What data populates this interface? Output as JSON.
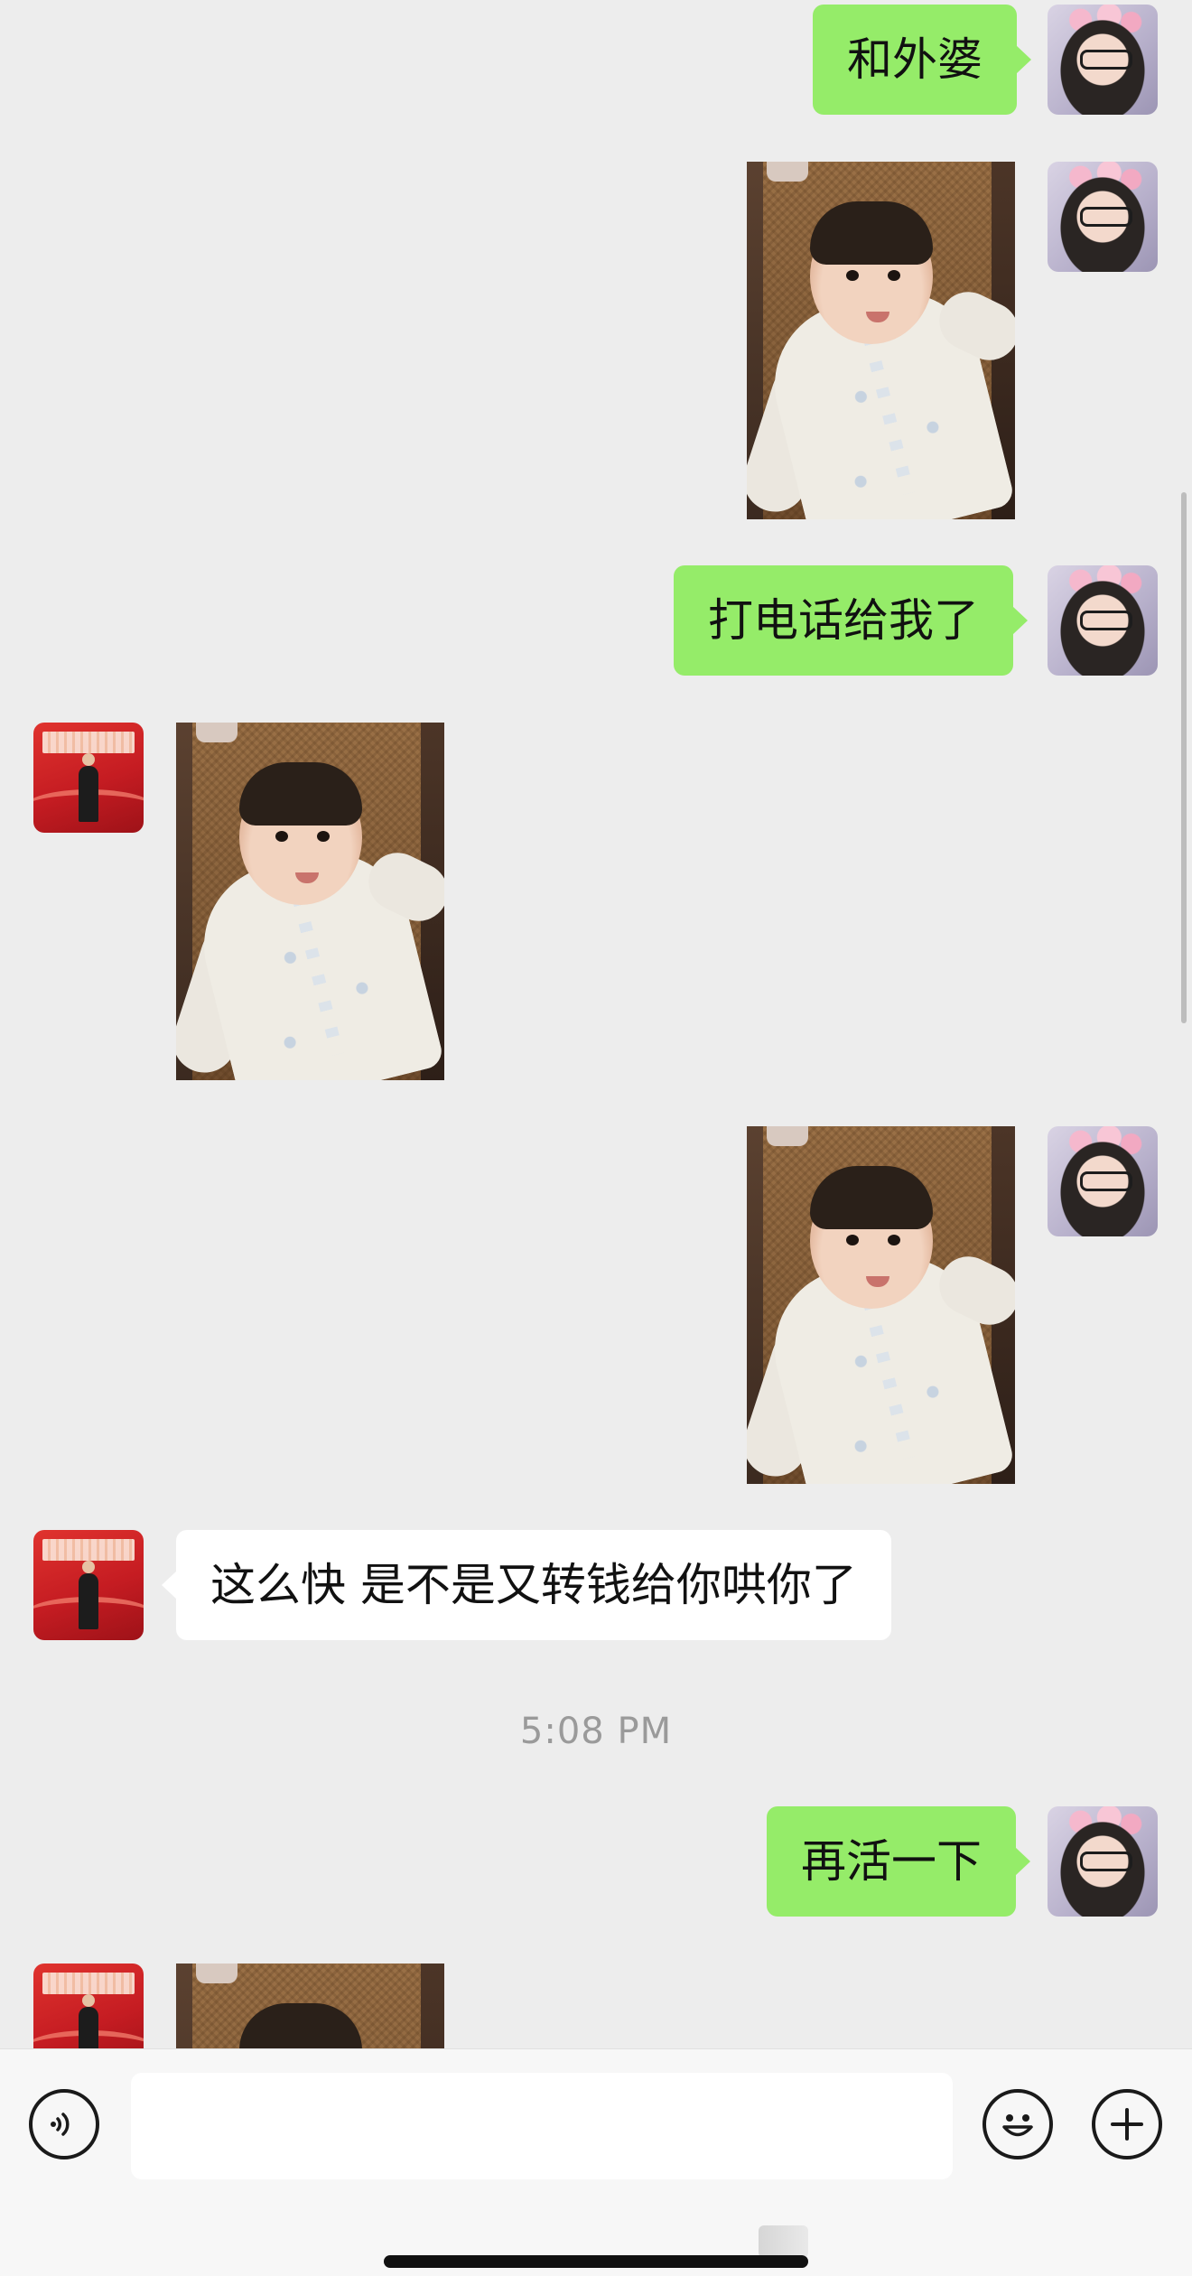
{
  "messages": [
    {
      "type": "text",
      "sender": "me",
      "text": "和外婆"
    },
    {
      "type": "image",
      "sender": "me",
      "image": "baby-photo"
    },
    {
      "type": "text",
      "sender": "me",
      "text": "打电话给我了"
    },
    {
      "type": "image",
      "sender": "them",
      "image": "baby-photo"
    },
    {
      "type": "image",
      "sender": "me",
      "image": "baby-photo"
    },
    {
      "type": "text",
      "sender": "them",
      "text": "这么快 是不是又转钱给你哄你了"
    },
    {
      "type": "timestamp",
      "text": "5:08 PM"
    },
    {
      "type": "text",
      "sender": "me",
      "text": "再活一下"
    },
    {
      "type": "image",
      "sender": "them",
      "image": "baby-photo"
    }
  ],
  "input_bar": {
    "voice_icon": "voice-icon",
    "emoji_icon": "emoji-icon",
    "plus_icon": "plus-icon",
    "message_value": ""
  },
  "colors": {
    "background": "#ededed",
    "my_bubble": "#95ec69",
    "their_bubble": "#ffffff",
    "timestamp_text": "#9a9a9a",
    "input_bar": "#f7f7f7"
  }
}
